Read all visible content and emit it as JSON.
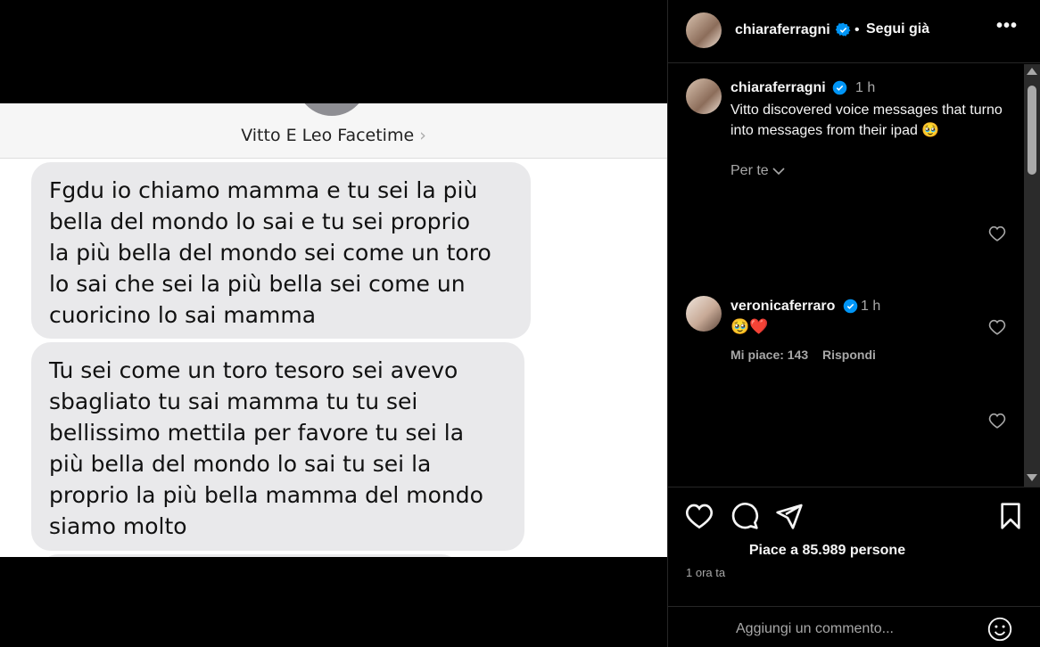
{
  "media": {
    "contact_name": "Vitto E Leo Facetime",
    "messages": [
      " Fgdu io chiamo mamma e tu sei la più\nbella del mondo lo sai e tu sei proprio\nla più bella del mondo sei come un toro\nlo sai che sei la più bella sei come un\ncuoricino lo sai mamma",
      "Tu sei come un toro tesoro sei avevo\nsbagliato tu sai mamma tu tu sei\nbellissimo mettila per favore tu sei la\npiù bella del mondo lo sai tu sei la\nproprio la più bella mamma del mondo\nsiamo molto"
    ]
  },
  "header": {
    "username": "chiaraferragni",
    "separator": "•",
    "follow_label": "Segui già",
    "more_label": "•••"
  },
  "caption": {
    "username": "chiaraferragni",
    "time": "1 h",
    "text": "Vitto discovered voice messages that turno into messages from their ipad 🥹",
    "translation_label": "Per te"
  },
  "comments": [
    {
      "username": "veronicaferraro",
      "time": "1 h",
      "text": "🥹❤️",
      "likes_label": "Mi piace: 143",
      "reply_label": "Rispondi"
    }
  ],
  "actions": {
    "likes_text": "Piace a 85.989 persone",
    "posted_ago": "1 ora ta"
  },
  "comment_input": {
    "placeholder": "Aggiungi un commento..."
  },
  "colors": {
    "verified": "#0095f6",
    "background": "#000000",
    "bubble": "#e9e9eb"
  },
  "icons": [
    "verified-icon",
    "more-icon",
    "heart-icon",
    "comment-icon",
    "share-icon",
    "bookmark-icon",
    "chevron-down-icon",
    "emoji-icon"
  ]
}
